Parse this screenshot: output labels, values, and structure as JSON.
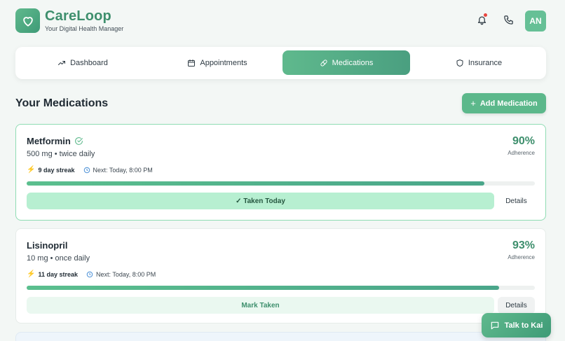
{
  "app": {
    "name": "CareLoop",
    "tagline": "Your Digital Health Manager",
    "avatar_initials": "AN"
  },
  "tabs": [
    {
      "label": "Dashboard",
      "icon": "trend-icon",
      "active": false
    },
    {
      "label": "Appointments",
      "icon": "calendar-icon",
      "active": false
    },
    {
      "label": "Medications",
      "icon": "pill-icon",
      "active": true
    },
    {
      "label": "Insurance",
      "icon": "shield-icon",
      "active": false
    }
  ],
  "section": {
    "title": "Your Medications",
    "add_label": "Add Medication"
  },
  "medications": [
    {
      "name": "Metformin",
      "dose": "500 mg • twice daily",
      "streak": "9 day streak",
      "next": "Next: Today, 8:00 PM",
      "adherence": "90%",
      "adherence_label": "Adherence",
      "progress_percent": 90,
      "action_label": "✓ Taken Today",
      "details_label": "Details",
      "verified": true
    },
    {
      "name": "Lisinopril",
      "dose": "10 mg • once daily",
      "streak": "11 day streak",
      "next": "Next: Today, 8:00 PM",
      "adherence": "93%",
      "adherence_label": "Adherence",
      "progress_percent": 93,
      "action_label": "Mark Taken",
      "details_label": "Details",
      "verified": false
    }
  ],
  "chat": {
    "label": "Talk to Kai"
  },
  "colors": {
    "brand": "#3e8f6d",
    "accent": "#5cb88b",
    "notification": "#e8463f"
  }
}
